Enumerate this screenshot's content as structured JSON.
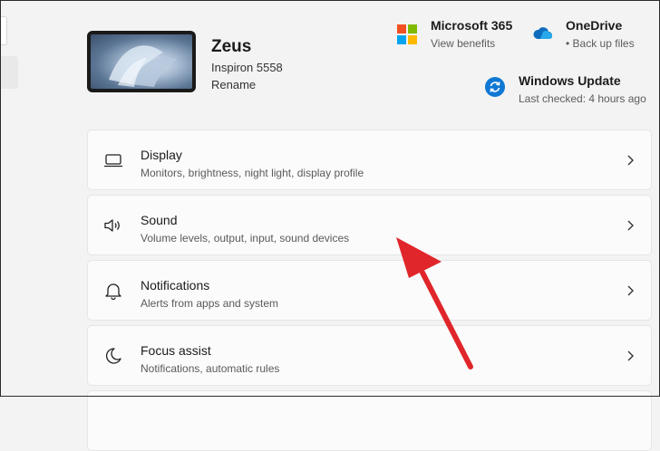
{
  "device": {
    "name": "Zeus",
    "model": "Inspiron 5558",
    "rename_label": "Rename"
  },
  "services": {
    "microsoft365": {
      "title": "Microsoft 365",
      "subtitle": "View benefits",
      "icon": "microsoft-logo-icon"
    },
    "onedrive": {
      "title": "OneDrive",
      "subtitle": "• Back up files",
      "icon": "onedrive-cloud-icon"
    },
    "windows_update": {
      "title": "Windows Update",
      "subtitle": "Last checked: 4 hours ago",
      "icon": "update-sync-icon"
    }
  },
  "settings": [
    {
      "label": "Display",
      "description": "Monitors, brightness, night light, display profile",
      "icon": "monitor-icon"
    },
    {
      "label": "Sound",
      "description": "Volume levels, output, input, sound devices",
      "icon": "speaker-icon"
    },
    {
      "label": "Notifications",
      "description": "Alerts from apps and system",
      "icon": "bell-icon"
    },
    {
      "label": "Focus assist",
      "description": "Notifications, automatic rules",
      "icon": "moon-icon"
    }
  ],
  "colors": {
    "accent": "#0067c0",
    "annotation_arrow": "#e0262b",
    "ms_red": "#f25022",
    "ms_green": "#7fba00",
    "ms_blue": "#00a4ef",
    "ms_yellow": "#ffb900"
  }
}
